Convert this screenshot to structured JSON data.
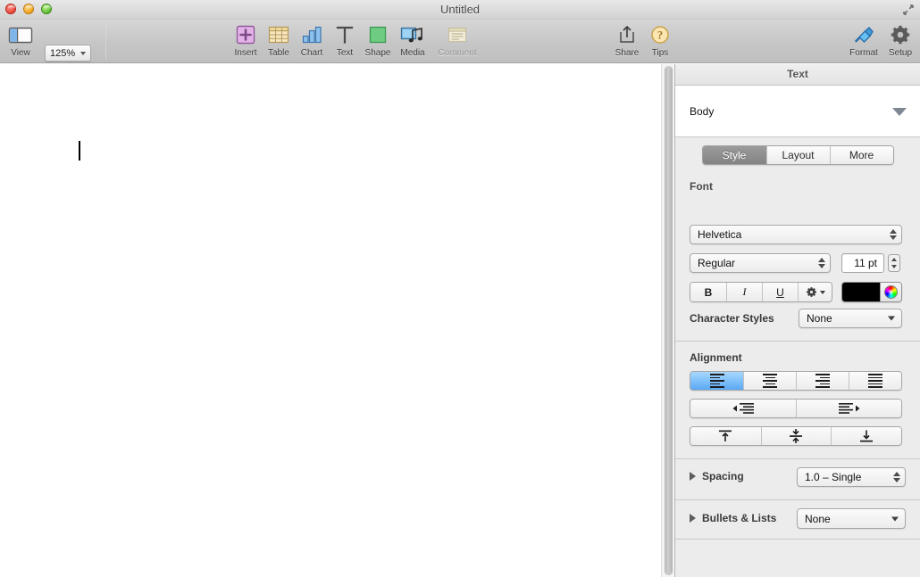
{
  "window": {
    "title": "Untitled",
    "traffic_lights": [
      "close",
      "minimize",
      "zoom"
    ],
    "fullscreen_icon": "expand-arrows-icon"
  },
  "toolbar": {
    "left_group": [
      {
        "id": "view",
        "label": "View",
        "icon": "view-sidebar-icon"
      }
    ],
    "zoom": {
      "label": "Zoom",
      "value": "125%",
      "icon": "chevron-down-icon"
    },
    "insert_group": [
      {
        "id": "insert",
        "label": "Insert",
        "icon": "plus-square-icon",
        "enabled": true
      },
      {
        "id": "table",
        "label": "Table",
        "icon": "table-grid-icon",
        "enabled": true
      },
      {
        "id": "chart",
        "label": "Chart",
        "icon": "bar-chart-icon",
        "enabled": true
      },
      {
        "id": "text",
        "label": "Text",
        "icon": "text-t-icon",
        "enabled": true
      },
      {
        "id": "shape",
        "label": "Shape",
        "icon": "square-shape-icon",
        "enabled": true
      },
      {
        "id": "media",
        "label": "Media",
        "icon": "photo-music-icon",
        "enabled": true
      },
      {
        "id": "comment",
        "label": "Comment",
        "icon": "sticky-note-icon",
        "enabled": false
      }
    ],
    "right_group": [
      {
        "id": "share",
        "label": "Share",
        "icon": "share-arrow-icon"
      },
      {
        "id": "tips",
        "label": "Tips",
        "icon": "question-circle-icon"
      },
      {
        "id": "format",
        "label": "Format",
        "icon": "paintbrush-icon"
      },
      {
        "id": "setup",
        "label": "Setup",
        "icon": "gear-icon"
      }
    ]
  },
  "document": {
    "caret_visible": true,
    "scrollbar": "vertical-scrollbar"
  },
  "inspector": {
    "title": "Text",
    "paragraph_style": {
      "value": "Body",
      "icon": "disclosure-triangle-icon"
    },
    "tabs": [
      {
        "id": "style",
        "label": "Style",
        "selected": true
      },
      {
        "id": "layout",
        "label": "Layout",
        "selected": false
      },
      {
        "id": "more",
        "label": "More",
        "selected": false
      }
    ],
    "font": {
      "section_label": "Font",
      "family": "Helvetica",
      "typeface": "Regular",
      "size": "11 pt",
      "bold_label": "B",
      "italic_label": "I",
      "underline_label": "U",
      "advanced_icon": "gear-icon",
      "text_color": "#000000",
      "color_wheel_icon": "color-wheel-icon",
      "character_styles_label": "Character Styles",
      "character_styles_value": "None"
    },
    "alignment": {
      "section_label": "Alignment",
      "horizontal": [
        {
          "id": "align-left",
          "icon": "align-left-icon",
          "selected": true
        },
        {
          "id": "align-center",
          "icon": "align-center-icon",
          "selected": false
        },
        {
          "id": "align-right",
          "icon": "align-right-icon",
          "selected": false
        },
        {
          "id": "align-justify",
          "icon": "align-justify-icon",
          "selected": false
        }
      ],
      "indent": [
        {
          "id": "outdent",
          "icon": "decrease-indent-icon"
        },
        {
          "id": "indent",
          "icon": "increase-indent-icon"
        }
      ],
      "vertical": [
        {
          "id": "align-top",
          "icon": "align-top-icon"
        },
        {
          "id": "align-middle",
          "icon": "align-middle-icon"
        },
        {
          "id": "align-bottom",
          "icon": "align-bottom-icon"
        }
      ]
    },
    "spacing": {
      "label": "Spacing",
      "value": "1.0 – Single",
      "twisty": "disclosure-triangle-right"
    },
    "bullets": {
      "label": "Bullets & Lists",
      "value": "None",
      "twisty": "disclosure-triangle-right"
    }
  },
  "colors": {
    "accent_blue": "#5aa9f5",
    "toolbar_top": "#d6d6d6",
    "toolbar_bottom": "#bfbfbf",
    "inspector_bg": "#ececec",
    "text_dark": "#1d1d1d"
  }
}
